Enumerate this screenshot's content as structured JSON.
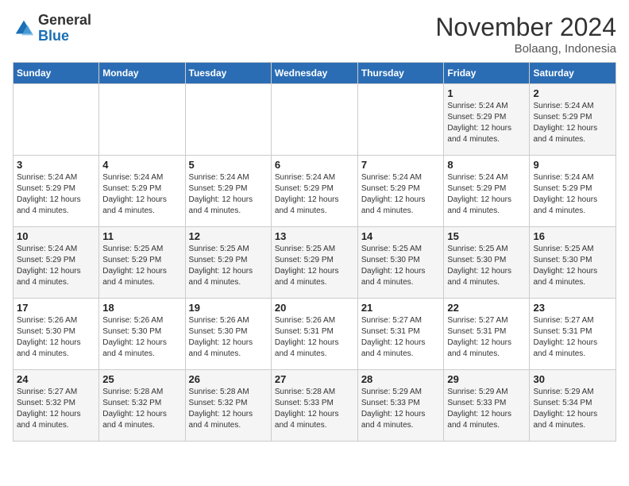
{
  "logo": {
    "text_general": "General",
    "text_blue": "Blue"
  },
  "header": {
    "month": "November 2024",
    "location": "Bolaang, Indonesia"
  },
  "weekdays": [
    "Sunday",
    "Monday",
    "Tuesday",
    "Wednesday",
    "Thursday",
    "Friday",
    "Saturday"
  ],
  "weeks": [
    [
      {
        "day": "",
        "sunrise": "",
        "sunset": "",
        "daylight": ""
      },
      {
        "day": "",
        "sunrise": "",
        "sunset": "",
        "daylight": ""
      },
      {
        "day": "",
        "sunrise": "",
        "sunset": "",
        "daylight": ""
      },
      {
        "day": "",
        "sunrise": "",
        "sunset": "",
        "daylight": ""
      },
      {
        "day": "",
        "sunrise": "",
        "sunset": "",
        "daylight": ""
      },
      {
        "day": "1",
        "sunrise": "Sunrise: 5:24 AM",
        "sunset": "Sunset: 5:29 PM",
        "daylight": "Daylight: 12 hours and 4 minutes."
      },
      {
        "day": "2",
        "sunrise": "Sunrise: 5:24 AM",
        "sunset": "Sunset: 5:29 PM",
        "daylight": "Daylight: 12 hours and 4 minutes."
      }
    ],
    [
      {
        "day": "3",
        "sunrise": "Sunrise: 5:24 AM",
        "sunset": "Sunset: 5:29 PM",
        "daylight": "Daylight: 12 hours and 4 minutes."
      },
      {
        "day": "4",
        "sunrise": "Sunrise: 5:24 AM",
        "sunset": "Sunset: 5:29 PM",
        "daylight": "Daylight: 12 hours and 4 minutes."
      },
      {
        "day": "5",
        "sunrise": "Sunrise: 5:24 AM",
        "sunset": "Sunset: 5:29 PM",
        "daylight": "Daylight: 12 hours and 4 minutes."
      },
      {
        "day": "6",
        "sunrise": "Sunrise: 5:24 AM",
        "sunset": "Sunset: 5:29 PM",
        "daylight": "Daylight: 12 hours and 4 minutes."
      },
      {
        "day": "7",
        "sunrise": "Sunrise: 5:24 AM",
        "sunset": "Sunset: 5:29 PM",
        "daylight": "Daylight: 12 hours and 4 minutes."
      },
      {
        "day": "8",
        "sunrise": "Sunrise: 5:24 AM",
        "sunset": "Sunset: 5:29 PM",
        "daylight": "Daylight: 12 hours and 4 minutes."
      },
      {
        "day": "9",
        "sunrise": "Sunrise: 5:24 AM",
        "sunset": "Sunset: 5:29 PM",
        "daylight": "Daylight: 12 hours and 4 minutes."
      }
    ],
    [
      {
        "day": "10",
        "sunrise": "Sunrise: 5:24 AM",
        "sunset": "Sunset: 5:29 PM",
        "daylight": "Daylight: 12 hours and 4 minutes."
      },
      {
        "day": "11",
        "sunrise": "Sunrise: 5:25 AM",
        "sunset": "Sunset: 5:29 PM",
        "daylight": "Daylight: 12 hours and 4 minutes."
      },
      {
        "day": "12",
        "sunrise": "Sunrise: 5:25 AM",
        "sunset": "Sunset: 5:29 PM",
        "daylight": "Daylight: 12 hours and 4 minutes."
      },
      {
        "day": "13",
        "sunrise": "Sunrise: 5:25 AM",
        "sunset": "Sunset: 5:29 PM",
        "daylight": "Daylight: 12 hours and 4 minutes."
      },
      {
        "day": "14",
        "sunrise": "Sunrise: 5:25 AM",
        "sunset": "Sunset: 5:30 PM",
        "daylight": "Daylight: 12 hours and 4 minutes."
      },
      {
        "day": "15",
        "sunrise": "Sunrise: 5:25 AM",
        "sunset": "Sunset: 5:30 PM",
        "daylight": "Daylight: 12 hours and 4 minutes."
      },
      {
        "day": "16",
        "sunrise": "Sunrise: 5:25 AM",
        "sunset": "Sunset: 5:30 PM",
        "daylight": "Daylight: 12 hours and 4 minutes."
      }
    ],
    [
      {
        "day": "17",
        "sunrise": "Sunrise: 5:26 AM",
        "sunset": "Sunset: 5:30 PM",
        "daylight": "Daylight: 12 hours and 4 minutes."
      },
      {
        "day": "18",
        "sunrise": "Sunrise: 5:26 AM",
        "sunset": "Sunset: 5:30 PM",
        "daylight": "Daylight: 12 hours and 4 minutes."
      },
      {
        "day": "19",
        "sunrise": "Sunrise: 5:26 AM",
        "sunset": "Sunset: 5:30 PM",
        "daylight": "Daylight: 12 hours and 4 minutes."
      },
      {
        "day": "20",
        "sunrise": "Sunrise: 5:26 AM",
        "sunset": "Sunset: 5:31 PM",
        "daylight": "Daylight: 12 hours and 4 minutes."
      },
      {
        "day": "21",
        "sunrise": "Sunrise: 5:27 AM",
        "sunset": "Sunset: 5:31 PM",
        "daylight": "Daylight: 12 hours and 4 minutes."
      },
      {
        "day": "22",
        "sunrise": "Sunrise: 5:27 AM",
        "sunset": "Sunset: 5:31 PM",
        "daylight": "Daylight: 12 hours and 4 minutes."
      },
      {
        "day": "23",
        "sunrise": "Sunrise: 5:27 AM",
        "sunset": "Sunset: 5:31 PM",
        "daylight": "Daylight: 12 hours and 4 minutes."
      }
    ],
    [
      {
        "day": "24",
        "sunrise": "Sunrise: 5:27 AM",
        "sunset": "Sunset: 5:32 PM",
        "daylight": "Daylight: 12 hours and 4 minutes."
      },
      {
        "day": "25",
        "sunrise": "Sunrise: 5:28 AM",
        "sunset": "Sunset: 5:32 PM",
        "daylight": "Daylight: 12 hours and 4 minutes."
      },
      {
        "day": "26",
        "sunrise": "Sunrise: 5:28 AM",
        "sunset": "Sunset: 5:32 PM",
        "daylight": "Daylight: 12 hours and 4 minutes."
      },
      {
        "day": "27",
        "sunrise": "Sunrise: 5:28 AM",
        "sunset": "Sunset: 5:33 PM",
        "daylight": "Daylight: 12 hours and 4 minutes."
      },
      {
        "day": "28",
        "sunrise": "Sunrise: 5:29 AM",
        "sunset": "Sunset: 5:33 PM",
        "daylight": "Daylight: 12 hours and 4 minutes."
      },
      {
        "day": "29",
        "sunrise": "Sunrise: 5:29 AM",
        "sunset": "Sunset: 5:33 PM",
        "daylight": "Daylight: 12 hours and 4 minutes."
      },
      {
        "day": "30",
        "sunrise": "Sunrise: 5:29 AM",
        "sunset": "Sunset: 5:34 PM",
        "daylight": "Daylight: 12 hours and 4 minutes."
      }
    ]
  ]
}
